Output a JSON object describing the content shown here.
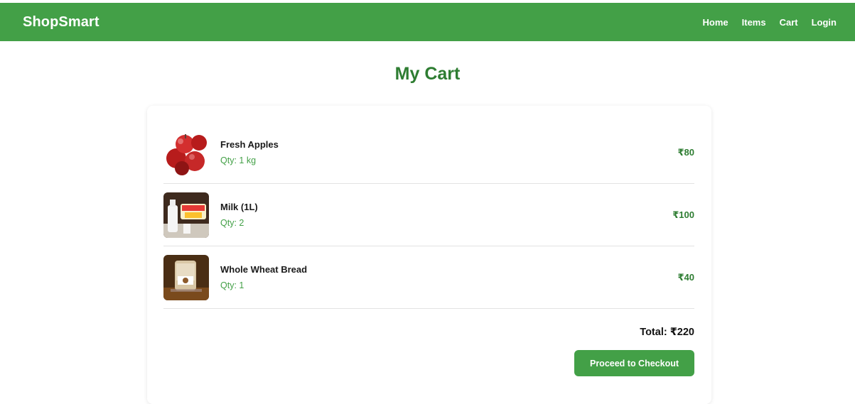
{
  "header": {
    "brand": "ShopSmart",
    "nav": [
      "Home",
      "Items",
      "Cart",
      "Login"
    ]
  },
  "page": {
    "title": "My Cart"
  },
  "cart": {
    "items": [
      {
        "name": "Fresh Apples",
        "qty": "Qty: 1 kg",
        "price": "₹80",
        "image_icon": "apples-photo-icon"
      },
      {
        "name": "Milk (1L)",
        "qty": "Qty: 2",
        "price": "₹100",
        "image_icon": "milk-photo-icon"
      },
      {
        "name": "Whole Wheat Bread",
        "qty": "Qty: 1",
        "price": "₹40",
        "image_icon": "bread-photo-icon"
      }
    ],
    "total": "Total: ₹220",
    "checkout_label": "Proceed to Checkout"
  },
  "colors": {
    "brand_green": "#43a047",
    "title_green": "#2e7d32"
  }
}
